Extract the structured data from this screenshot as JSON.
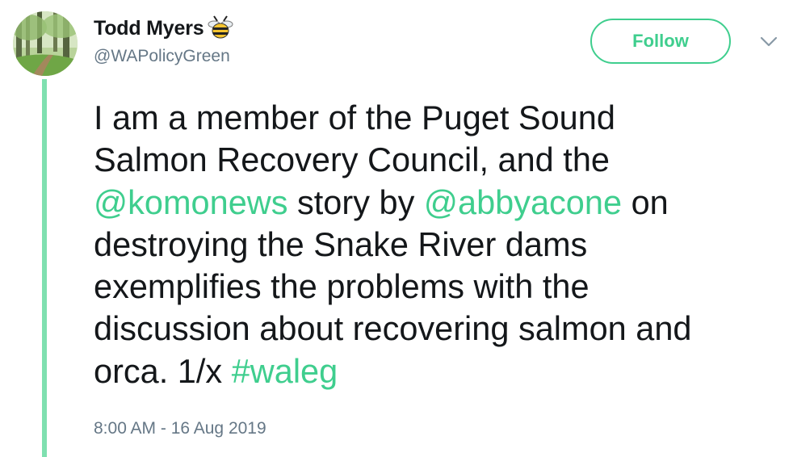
{
  "author": {
    "display_name": "Todd Myers",
    "handle": "@WAPolicyGreen",
    "avatar_icon": "forest-avatar",
    "badge_icon": "bee-icon"
  },
  "actions": {
    "follow_label": "Follow",
    "menu_icon": "chevron-down-icon"
  },
  "tweet": {
    "lines": [
      [
        {
          "text": "I am a member of the Puget Sound",
          "link": false
        }
      ],
      [
        {
          "text": "Salmon Recovery Council, and the",
          "link": false
        }
      ],
      [
        {
          "text": "@komonews",
          "link": true
        },
        {
          "text": " story by ",
          "link": false
        },
        {
          "text": "@abbyacone",
          "link": true
        },
        {
          "text": " on",
          "link": false
        }
      ],
      [
        {
          "text": "destroying the Snake River dams",
          "link": false
        }
      ],
      [
        {
          "text": "exemplifies the problems with the",
          "link": false
        }
      ],
      [
        {
          "text": "discussion about recovering salmon and",
          "link": false
        }
      ],
      [
        {
          "text": "orca. 1/x ",
          "link": false
        },
        {
          "text": "#waleg",
          "link": true
        }
      ]
    ],
    "timestamp": "8:00 AM - 16 Aug 2019"
  },
  "colors": {
    "accent": "#3fce8e",
    "thread_line": "#7fe0b0",
    "text": "#14171a",
    "secondary_text": "#657786"
  }
}
